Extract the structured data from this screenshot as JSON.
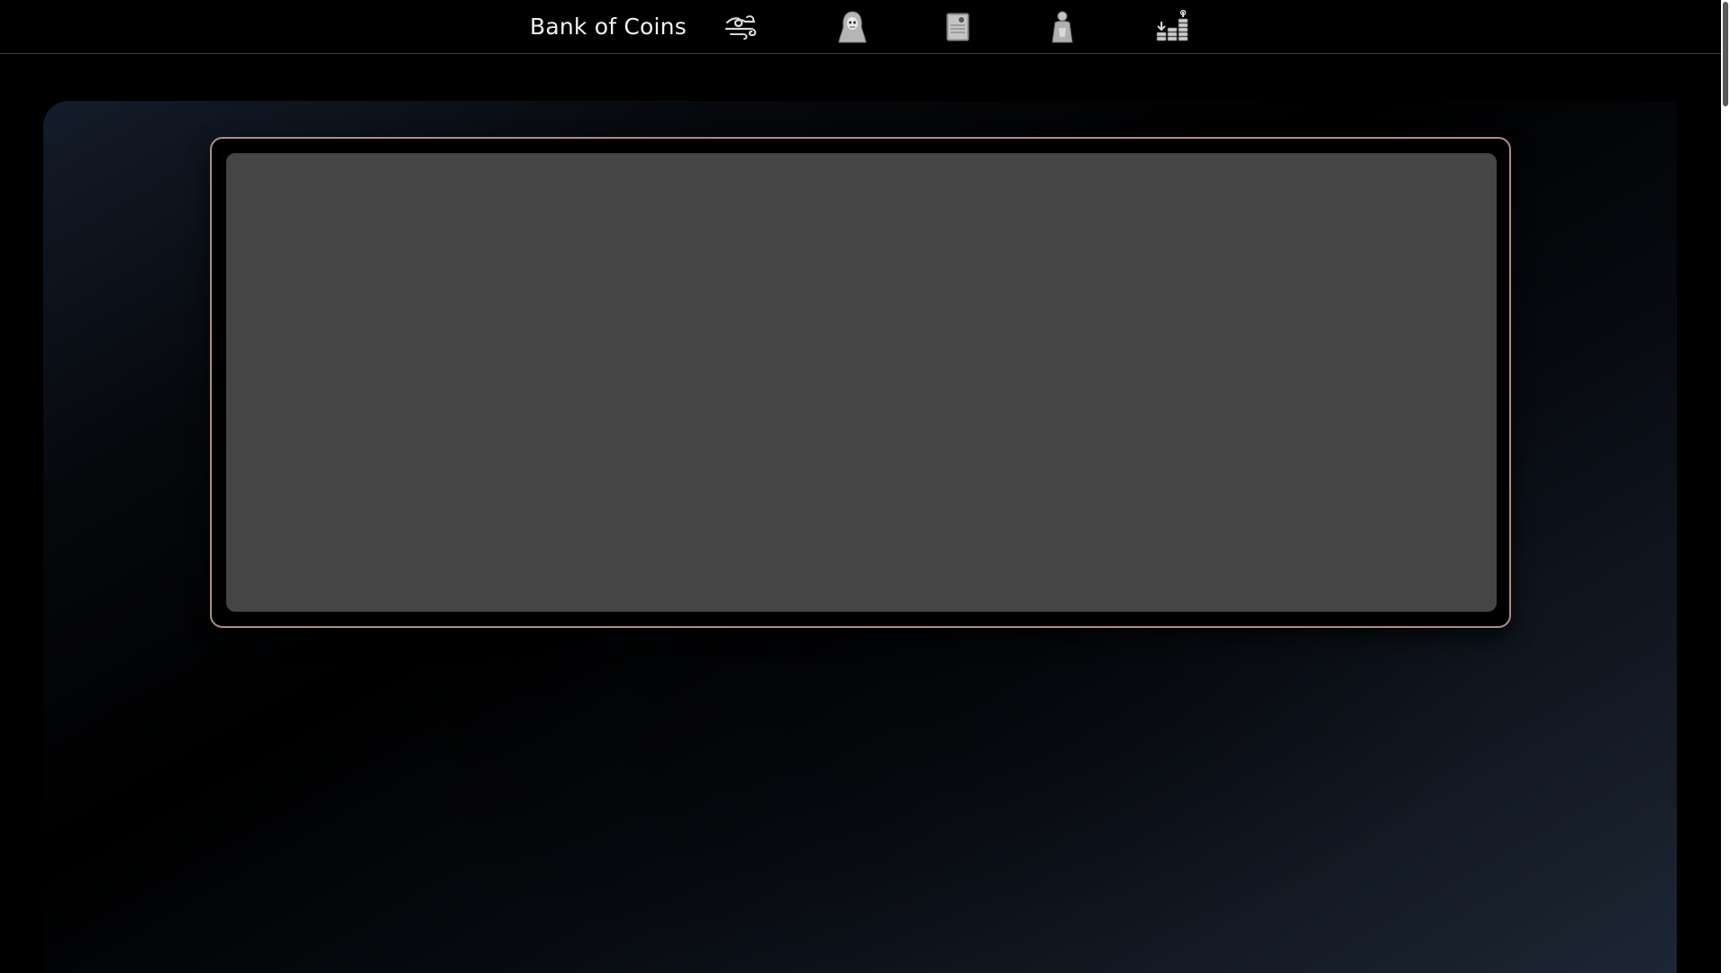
{
  "navbar": {
    "brand": "Bank of Coins",
    "icons": [
      {
        "name": "wind-icon",
        "color": "#d8d8d8"
      },
      {
        "name": "grim-reaper-icon",
        "color": "#bdbdbd"
      },
      {
        "name": "ledger-skull-icon",
        "color": "#bdbdbd"
      },
      {
        "name": "hooded-figure-icon",
        "color": "#bdbdbd"
      },
      {
        "name": "coin-stacks-icon",
        "color": "#d0d0d0"
      }
    ]
  },
  "theme": {
    "background": "#000000",
    "frame_border": "#b08c86",
    "content_fill": "#454545",
    "text": "#f2f2f2"
  }
}
